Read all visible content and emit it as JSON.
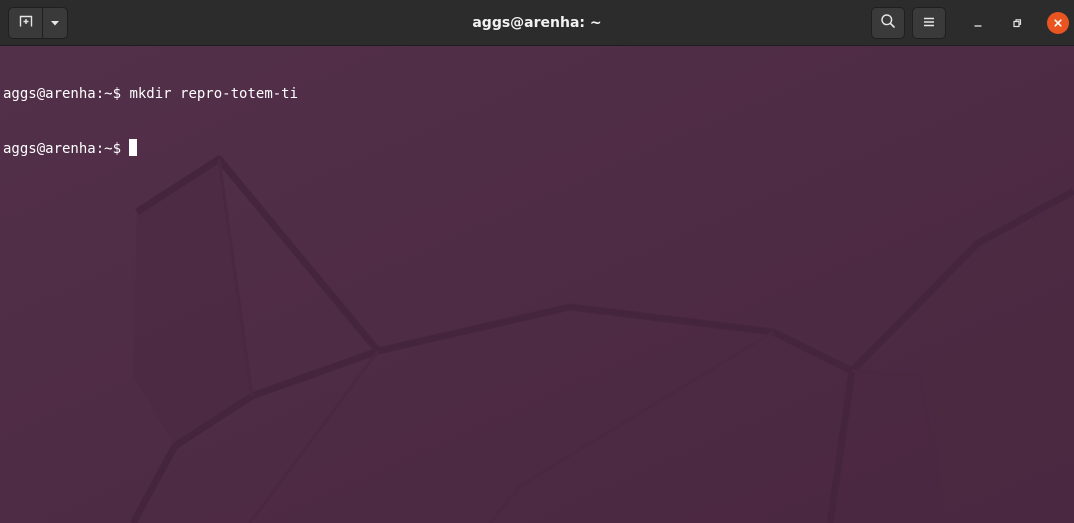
{
  "window": {
    "title": "aggs@arenha: ~"
  },
  "headerbar": {
    "new_tab_icon": "new-tab-icon",
    "tab_menu_icon": "chevron-down-icon",
    "search_icon": "search-icon",
    "menu_icon": "hamburger-menu-icon",
    "minimize_icon": "minimize-icon",
    "maximize_icon": "restore-icon",
    "close_icon": "close-icon",
    "close_color": "#e95420"
  },
  "terminal": {
    "background_color": "#4f2c45",
    "lines": [
      {
        "prompt": "aggs@arenha:~$",
        "command": "mkdir repro-totem-ti"
      },
      {
        "prompt": "aggs@arenha:~$",
        "command": ""
      }
    ]
  }
}
